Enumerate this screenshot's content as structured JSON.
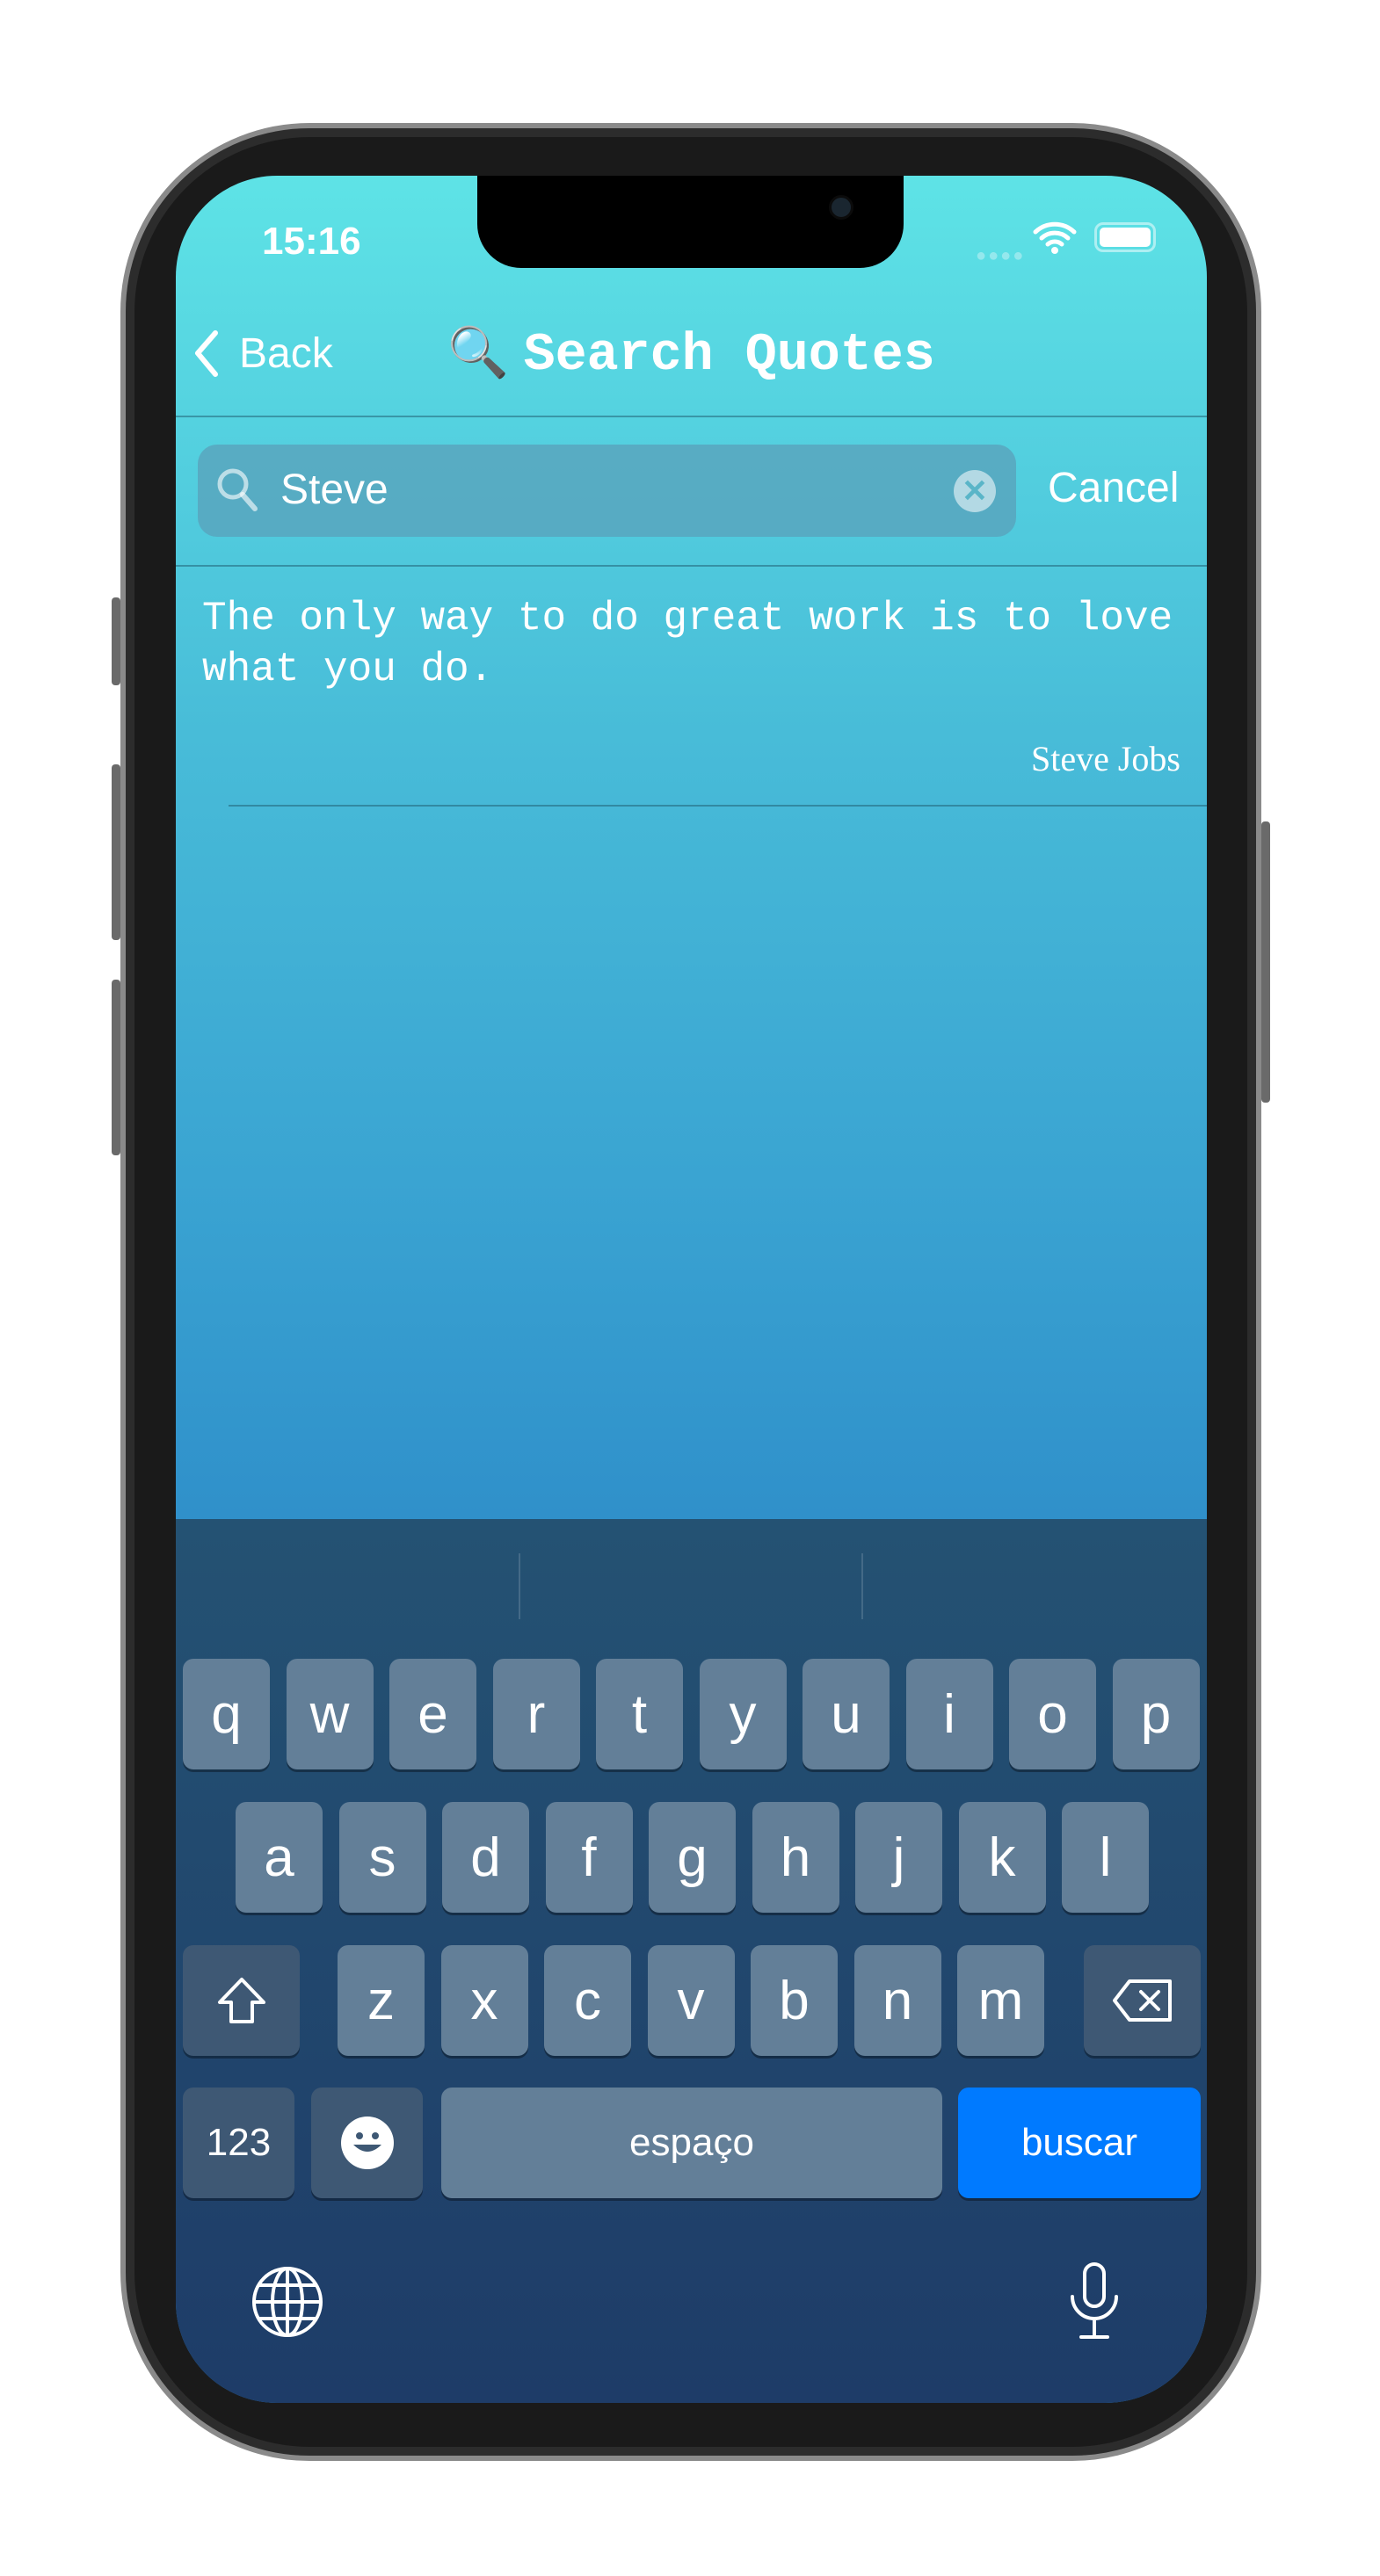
{
  "status_bar": {
    "time": "15:16"
  },
  "nav": {
    "back_label": "Back",
    "title": "Search Quotes",
    "title_emoji": "🔍"
  },
  "search": {
    "value": "Steve",
    "cancel_label": "Cancel"
  },
  "results": [
    {
      "quote": "The only way to do great work is to love what you do.",
      "author": "Steve Jobs"
    }
  ],
  "keyboard": {
    "row1": [
      "q",
      "w",
      "e",
      "r",
      "t",
      "y",
      "u",
      "i",
      "o",
      "p"
    ],
    "row2": [
      "a",
      "s",
      "d",
      "f",
      "g",
      "h",
      "j",
      "k",
      "l"
    ],
    "row3": [
      "z",
      "x",
      "c",
      "v",
      "b",
      "n",
      "m"
    ],
    "numbers_label": "123",
    "space_label": "espaço",
    "return_label": "buscar",
    "return_color": "#007aff"
  }
}
